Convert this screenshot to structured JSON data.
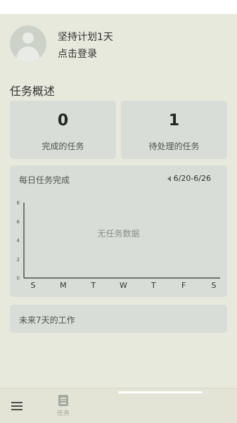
{
  "profile": {
    "name": "坚持计划1天",
    "login": "点击登录"
  },
  "overview": {
    "title": "任务概述",
    "stats": [
      {
        "value": "0",
        "label": "完成的任务"
      },
      {
        "value": "1",
        "label": "待处理的任务"
      }
    ]
  },
  "chart": {
    "title": "每日任务完成",
    "range": "6/20-6/26",
    "empty_text": "无任务数据"
  },
  "chart_data": {
    "type": "bar",
    "title": "每日任务完成",
    "categories": [
      "S",
      "M",
      "T",
      "W",
      "T",
      "F",
      "S"
    ],
    "values": [
      0,
      0,
      0,
      0,
      0,
      0,
      0
    ],
    "ylim": [
      0,
      8
    ],
    "yticks": [
      0,
      2,
      4,
      6,
      8
    ],
    "grid": false
  },
  "week": {
    "label": "未来7天的工作"
  },
  "bottom_nav": {
    "tasks_label": "任务"
  },
  "colors": {
    "background": "#e8e9dd",
    "card": "#d9ddd7",
    "accent_text": "#303330"
  }
}
